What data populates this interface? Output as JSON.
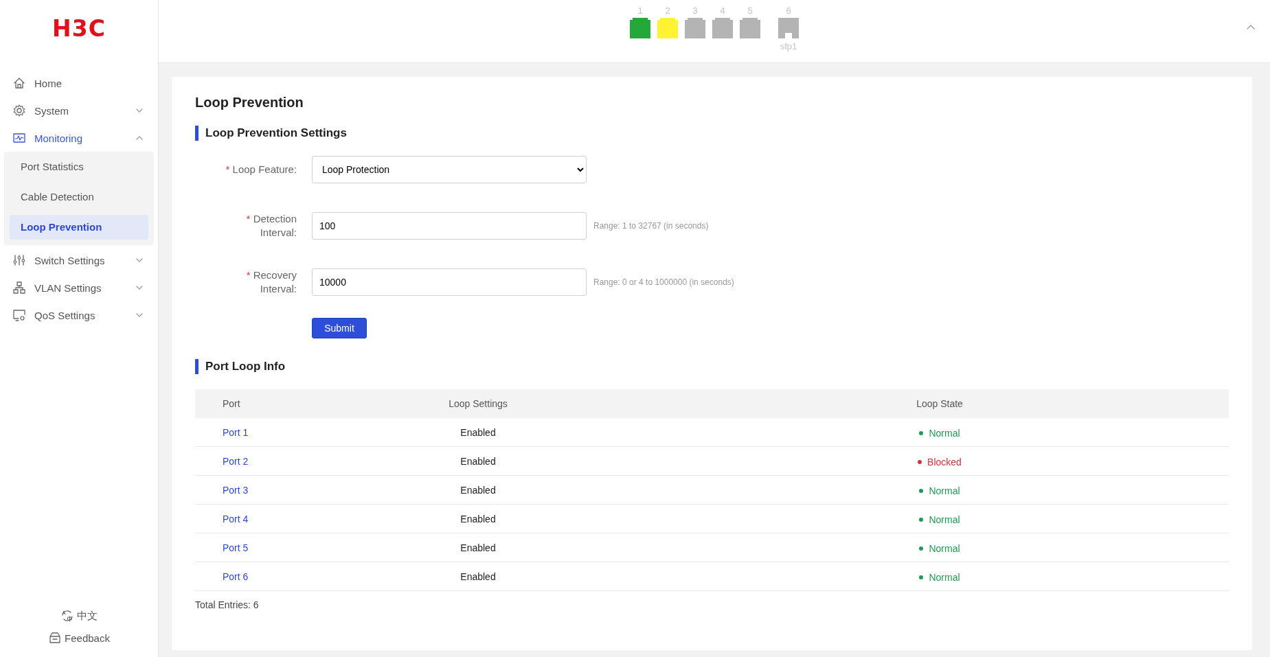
{
  "logo": "H3C",
  "ports": [
    {
      "number": "1",
      "kind": "rj45",
      "color": "#25a83a"
    },
    {
      "number": "2",
      "kind": "rj45",
      "color": "#fff333"
    },
    {
      "number": "3",
      "kind": "rj45",
      "color": "#b4b4b4"
    },
    {
      "number": "4",
      "kind": "rj45",
      "color": "#b4b4b4"
    },
    {
      "number": "5",
      "kind": "rj45",
      "color": "#b4b4b4"
    },
    {
      "number": "6",
      "kind": "sfp",
      "color": "#b4b4b4",
      "label": "sfp1"
    }
  ],
  "sidebar": {
    "items": [
      {
        "label": "Home",
        "selected": false
      },
      {
        "label": "System",
        "selected": false,
        "expanded": false
      },
      {
        "label": "Monitoring",
        "selected": true,
        "expanded": true,
        "children": [
          {
            "label": "Port Statistics",
            "selected": false
          },
          {
            "label": "Cable Detection",
            "selected": false
          },
          {
            "label": "Loop Prevention",
            "selected": true
          }
        ]
      },
      {
        "label": "Switch Settings",
        "selected": false,
        "expanded": false
      },
      {
        "label": "VLAN Settings",
        "selected": false,
        "expanded": false
      },
      {
        "label": "QoS Settings",
        "selected": false,
        "expanded": false
      }
    ],
    "language": "中文",
    "feedback": "Feedback"
  },
  "page_title": "Loop Prevention",
  "settings": {
    "title": "Loop Prevention Settings",
    "fields": [
      {
        "kind": "select",
        "required_mark": "*",
        "label": "Loop Feature:",
        "value": "Loop Protection"
      },
      {
        "kind": "text",
        "required_mark": "*",
        "label": "Detection Interval:",
        "value": "100",
        "hint": "Range: 1 to 32767 (in seconds)"
      },
      {
        "kind": "text",
        "required_mark": "*",
        "label": "Recovery Interval:",
        "value": "10000",
        "hint": "Range: 0 or 4 to 1000000 (in seconds)"
      }
    ],
    "submit": "Submit"
  },
  "port_loop_info": {
    "title": "Port Loop Info",
    "columns": [
      "Port",
      "Loop Settings",
      "Loop State"
    ],
    "rows": [
      {
        "port": "Port 1",
        "settings": "Enabled",
        "state": "Normal",
        "color": "#1f9a55"
      },
      {
        "port": "Port 2",
        "settings": "Enabled",
        "state": "Blocked",
        "color": "#d0343c"
      },
      {
        "port": "Port 3",
        "settings": "Enabled",
        "state": "Normal",
        "color": "#1f9a55"
      },
      {
        "port": "Port 4",
        "settings": "Enabled",
        "state": "Normal",
        "color": "#1f9a55"
      },
      {
        "port": "Port 5",
        "settings": "Enabled",
        "state": "Normal",
        "color": "#1f9a55"
      },
      {
        "port": "Port 6",
        "settings": "Enabled",
        "state": "Normal",
        "color": "#1f9a55"
      }
    ],
    "total": "Total Entries: 6"
  }
}
